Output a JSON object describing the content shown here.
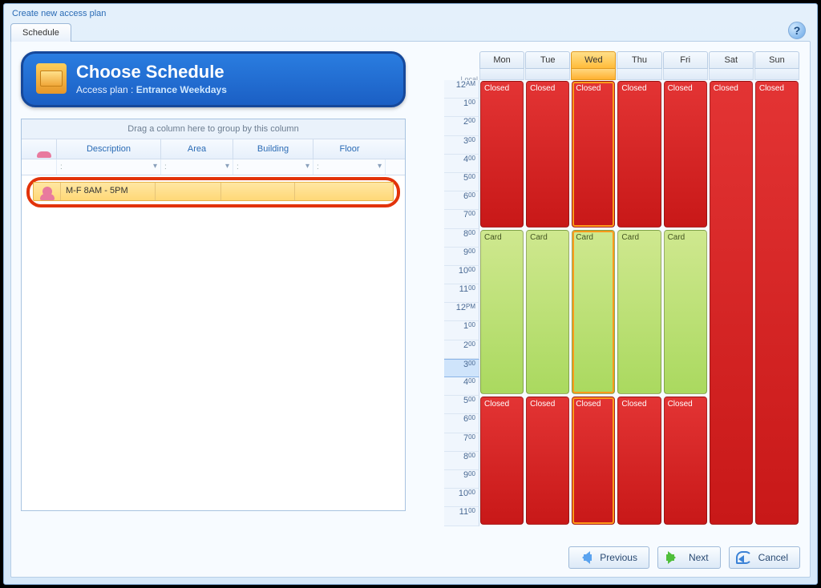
{
  "window": {
    "title": "Create new access plan"
  },
  "tab": {
    "label": "Schedule"
  },
  "header": {
    "title": "Choose Schedule",
    "subtitle_prefix": "Access plan : ",
    "plan_name": "Entrance Weekdays"
  },
  "grid": {
    "group_hint": "Drag a column here to group by this column",
    "columns": {
      "icon": "",
      "description": "Description",
      "area": "Area",
      "building": "Building",
      "floor": "Floor"
    },
    "filter_placeholder": ":",
    "row": {
      "description": "M-F 8AM - 5PM",
      "area": "",
      "building": "",
      "floor": ""
    }
  },
  "calendar": {
    "local_label": "Local",
    "days": [
      "Mon",
      "Tue",
      "Wed",
      "Thu",
      "Fri",
      "Sat",
      "Sun"
    ],
    "selected_day_index": 2,
    "hours": [
      "12AM",
      "1:00",
      "2:00",
      "3:00",
      "4:00",
      "5:00",
      "6:00",
      "7:00",
      "8:00",
      "9:00",
      "10:00",
      "11:00",
      "12PM",
      "1:00",
      "2:00",
      "3:00",
      "4:00",
      "5:00",
      "6:00",
      "7:00",
      "8:00",
      "9:00",
      "10:00",
      "11:00"
    ],
    "now_hour_index": 15,
    "labels": {
      "closed": "Closed",
      "card": "Card"
    },
    "weekday_segments": [
      {
        "kind": "closed",
        "start": 0,
        "end": 8
      },
      {
        "kind": "card",
        "start": 8,
        "end": 17
      },
      {
        "kind": "closed",
        "start": 17,
        "end": 24
      }
    ],
    "weekend_segments": [
      {
        "kind": "closed",
        "start": 0,
        "end": 24
      }
    ]
  },
  "buttons": {
    "previous": "Previous",
    "next": "Next",
    "cancel": "Cancel"
  },
  "colors": {
    "closed": "#d21f1f",
    "card": "#b7df6f",
    "accent": "#1f5fb8",
    "highlight": "#e2330a"
  }
}
